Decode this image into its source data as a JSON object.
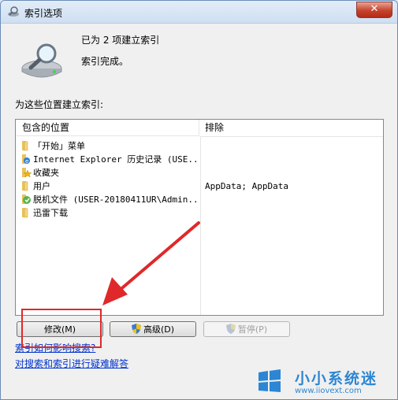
{
  "window": {
    "title": "索引选项",
    "close_symbol": "✕"
  },
  "status": {
    "indexed_count": "已为 2 项建立索引",
    "state": "索引完成。"
  },
  "section_label": "为这些位置建立索引:",
  "columns": {
    "location": "包含的位置",
    "exclude": "排除"
  },
  "locations": [
    {
      "icon": "folder-icon",
      "name": "「开始」菜单"
    },
    {
      "icon": "ie-icon",
      "name": "Internet Explorer 历史记录 (USE..."
    },
    {
      "icon": "favorites-folder-icon",
      "name": "收藏夹"
    },
    {
      "icon": "folder-icon",
      "name": "用户"
    },
    {
      "icon": "offline-files-icon",
      "name": "脱机文件 (USER-20180411UR\\Admin..."
    },
    {
      "icon": "folder-icon",
      "name": "迅雷下载"
    }
  ],
  "excludes": [
    {
      "row": 3,
      "text": "AppData; AppData"
    }
  ],
  "buttons": {
    "modify": "修改(M)",
    "advanced": "高级(D)",
    "pause": "暂停(P)"
  },
  "links": {
    "how_indexing": "索引如何影响搜索?",
    "troubleshoot": "对搜索和索引进行疑难解答"
  },
  "watermark": {
    "text": "小小系统迷",
    "url": "www.iiovext.com"
  },
  "colors": {
    "annotation_red": "#e0282a",
    "link": "#0033cc"
  }
}
